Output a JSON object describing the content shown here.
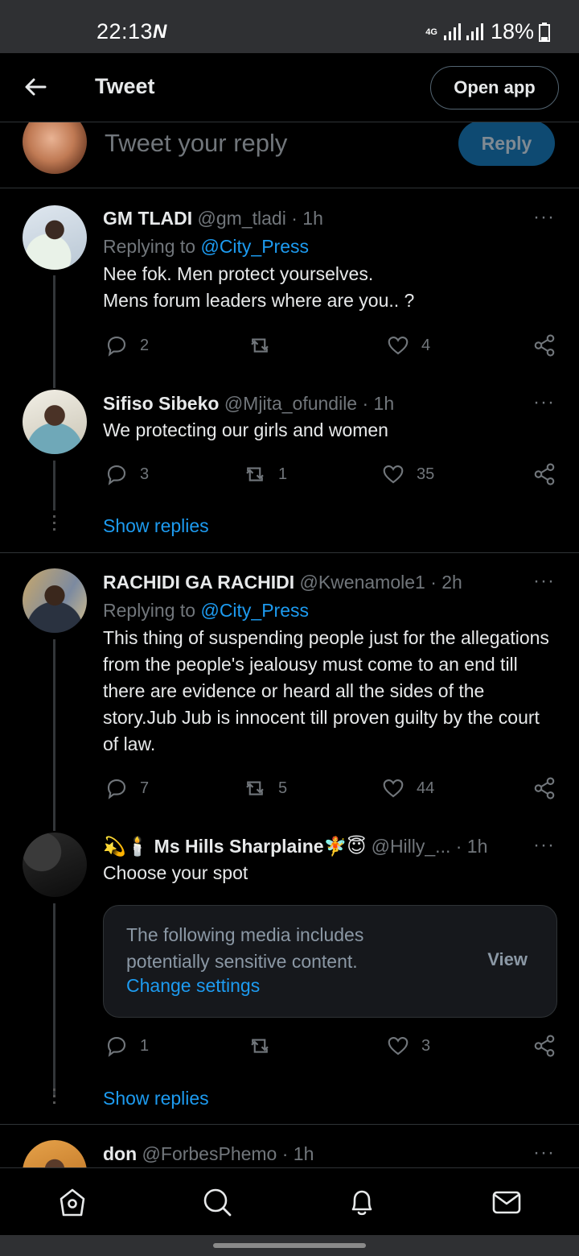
{
  "status_bar": {
    "time": "22:13",
    "network": "4G",
    "battery": "18%"
  },
  "top_bar": {
    "title": "Tweet",
    "open_app_label": "Open app"
  },
  "compose": {
    "placeholder": "Tweet your reply",
    "reply_label": "Reply"
  },
  "tweets": [
    {
      "name": "GM TLADI",
      "handle": "@gm_tladi",
      "time": "· 1h",
      "replying_prefix": "Replying to ",
      "replying_to": "@City_Press",
      "text": "Nee fok. Men protect yourselves.\nMens forum leaders  where are you..  ?",
      "replies": "2",
      "retweets": "",
      "likes": "4"
    },
    {
      "name": "Sifiso Sibeko",
      "handle": "@Mjita_ofundile",
      "time": "· 1h",
      "text": "We protecting our girls and women",
      "replies": "3",
      "retweets": "1",
      "likes": "35"
    },
    {
      "name": "RACHIDI GA RACHIDI",
      "handle": "@Kwenamole1",
      "time": "· 2h",
      "replying_prefix": "Replying to ",
      "replying_to": "@City_Press",
      "text": "This thing of suspending people just for the allegations from the people's jealousy must come to an end till there are evidence or heard all the sides of the story.Jub Jub is innocent till proven guilty by the court of law.",
      "replies": "7",
      "retweets": "5",
      "likes": "44"
    },
    {
      "name_prefix": "💫🕯️",
      "name": "Ms Hills Sharplaine",
      "name_suffix": "🧚😇",
      "handle": "@Hilly_...",
      "time": "· 1h",
      "text": "Choose your spot",
      "sensitive_text": "The following media includes potentially sensitive content.",
      "sensitive_link": "Change settings",
      "sensitive_view": "View",
      "replies": "1",
      "retweets": "",
      "likes": "3"
    },
    {
      "name": "don",
      "handle": "@ForbesPhemo",
      "time": "· 1h"
    }
  ],
  "show_replies_label": "Show replies",
  "more_icon": "···",
  "bottom_nav": [
    "home-icon",
    "search-icon",
    "notifications-icon",
    "messages-icon"
  ]
}
